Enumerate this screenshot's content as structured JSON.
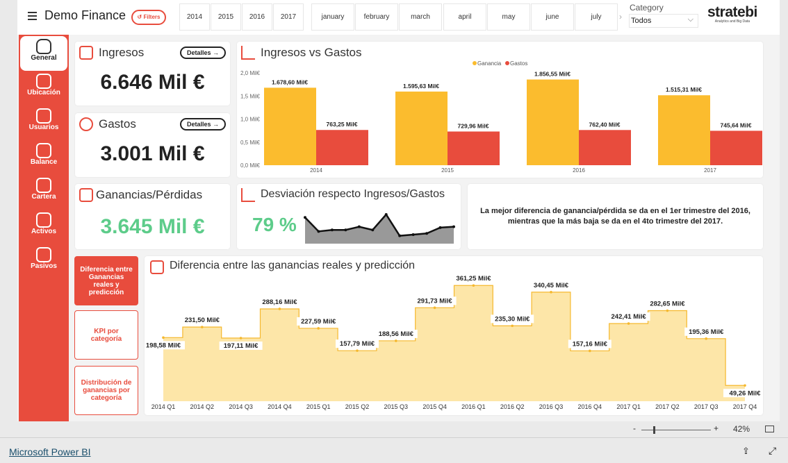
{
  "header": {
    "title": "Demo Finance",
    "filters_label": "Filters",
    "years": [
      "2014",
      "2015",
      "2016",
      "2017"
    ],
    "months": [
      "january",
      "february",
      "march",
      "april",
      "may",
      "june",
      "july"
    ],
    "category_label": "Category",
    "category_value": "Todos",
    "logo": "stratebi",
    "logo_sub": "Analytics and Big Data"
  },
  "sidebar": {
    "items": [
      {
        "label": "General",
        "icon": "home-icon"
      },
      {
        "label": "Ubicación",
        "icon": "location-icon"
      },
      {
        "label": "Usuarios",
        "icon": "users-icon"
      },
      {
        "label": "Balance",
        "icon": "money-bag-icon"
      },
      {
        "label": "Cartera",
        "icon": "wallet-icon"
      },
      {
        "label": "Activos",
        "icon": "check-icon"
      },
      {
        "label": "Pasivos",
        "icon": "minus-icon"
      }
    ]
  },
  "kpis": {
    "ingresos": {
      "title": "Ingresos",
      "value": "6.646 Mil €",
      "details": "Detalles"
    },
    "gastos": {
      "title": "Gastos",
      "value": "3.001 Mil €",
      "details": "Detalles"
    },
    "ganancias": {
      "title": "Ganancias/Pérdidas",
      "value": "3.645 Mil €"
    },
    "desviacion": {
      "title": "Desviación respecto Ingresos/Gastos",
      "value": "79 %"
    }
  },
  "insight": "La mejor diferencia de ganancia/pérdida se da en el 1er trimestre del 2016, mientras que la más baja se da en el 4to trimestre del 2017.",
  "side_buttons": [
    "Diferencia entre Ganancias reales y predicción",
    "KPI por categoría",
    "Distribución de ganancias por categoría"
  ],
  "colors": {
    "accent": "#e84c3d",
    "ganancia": "#fbbc2e",
    "gastos": "#e84c3d",
    "green": "#5dcc8a",
    "step_fill": "#fde6a8"
  },
  "chart_data": [
    {
      "type": "bar",
      "title": "Ingresos vs Gastos",
      "categories": [
        "2014",
        "2015",
        "2016",
        "2017"
      ],
      "series": [
        {
          "name": "Ganancia",
          "values": [
            1678.6,
            1595.63,
            1856.55,
            1515.31
          ],
          "labels": [
            "1.678,60 Mil€",
            "1.595,63 Mil€",
            "1.856,55 Mil€",
            "1.515,31 Mil€"
          ]
        },
        {
          "name": "Gastos",
          "values": [
            763.25,
            729.96,
            762.4,
            745.64
          ],
          "labels": [
            "763,25 Mil€",
            "729,96 Mil€",
            "762,40 Mil€",
            "745,64 Mil€"
          ]
        }
      ],
      "yticks": [
        "0,0 Mil€",
        "0,5 Mil€",
        "1,0 Mil€",
        "1,5 Mil€",
        "2,0 Mil€"
      ],
      "ylim": [
        0,
        2000
      ],
      "legend": "top-center"
    },
    {
      "type": "line",
      "sparkline": true,
      "values": [
        0.9,
        0.42,
        0.47,
        0.47,
        0.58,
        0.47,
        1.0,
        0.27,
        0.31,
        0.35,
        0.55,
        0.58
      ]
    },
    {
      "type": "area",
      "title": "Diferencia entre las ganancias reales y predicción",
      "categories": [
        "2014 Q1",
        "2014 Q2",
        "2014 Q3",
        "2014 Q4",
        "2015 Q1",
        "2015 Q2",
        "2015 Q3",
        "2015 Q4",
        "2016 Q1",
        "2016 Q2",
        "2016 Q3",
        "2016 Q4",
        "2017 Q1",
        "2017 Q2",
        "2017 Q3",
        "2017 Q4"
      ],
      "values": [
        198.58,
        231.5,
        197.11,
        288.16,
        227.59,
        157.79,
        188.56,
        291.73,
        361.25,
        235.3,
        340.45,
        157.16,
        242.41,
        282.65,
        195.36,
        49.26
      ],
      "labels": [
        "198,58 Mil€",
        "231,50 Mil€",
        "197,11 Mil€",
        "288,16 Mil€",
        "227,59 Mil€",
        "157,79 Mil€",
        "188,56 Mil€",
        "291,73 Mil€",
        "361,25 Mil€",
        "235,30 Mil€",
        "340,45 Mil€",
        "157,16 Mil€",
        "242,41 Mil€",
        "282,65 Mil€",
        "195,36 Mil€",
        "49,26 Mil€"
      ],
      "step": "middle"
    }
  ],
  "zoom": {
    "level": "42%",
    "minus": "-",
    "plus": "+"
  },
  "footer": {
    "link": "Microsoft Power BI"
  }
}
